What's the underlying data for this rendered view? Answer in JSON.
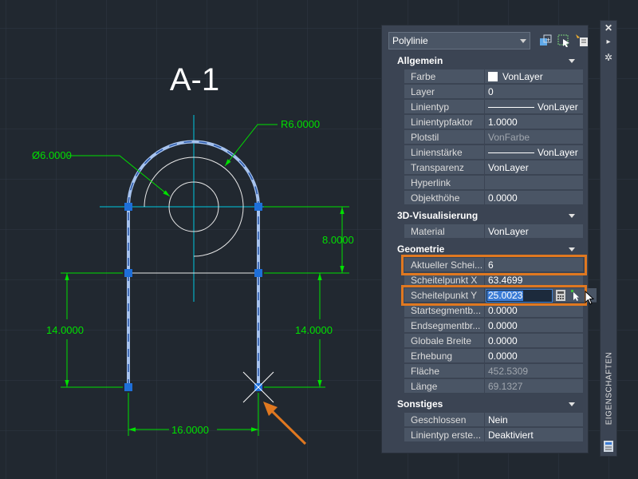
{
  "drawing": {
    "title": "A-1",
    "dim_diameter": "Ø6.0000",
    "dim_radius": "R6.0000",
    "dim_right_top": "8.0000",
    "dim_left": "14.0000",
    "dim_right": "14.0000",
    "dim_bottom": "16.0000"
  },
  "panel": {
    "object_type": "Polylinie",
    "vertical_title": "EIGENSCHAFTEN",
    "sections": [
      {
        "title": "Allgemein",
        "rows": [
          {
            "label": "Farbe",
            "value": "VonLayer"
          },
          {
            "label": "Layer",
            "value": "0"
          },
          {
            "label": "Linientyp",
            "value": "VonLayer"
          },
          {
            "label": "Linientypfaktor",
            "value": "1.0000"
          },
          {
            "label": "Plotstil",
            "value": "VonFarbe"
          },
          {
            "label": "Linienstärke",
            "value": "VonLayer"
          },
          {
            "label": "Transparenz",
            "value": "VonLayer"
          },
          {
            "label": "Hyperlink",
            "value": ""
          },
          {
            "label": "Objekthöhe",
            "value": "0.0000"
          }
        ]
      },
      {
        "title": "3D-Visualisierung",
        "rows": [
          {
            "label": "Material",
            "value": "VonLayer"
          }
        ]
      },
      {
        "title": "Geometrie",
        "rows": [
          {
            "label": "Aktueller Schei...",
            "value": "6"
          },
          {
            "label": "Scheitelpunkt X",
            "value": "63.4699"
          },
          {
            "label": "Scheitelpunkt Y",
            "value": "25.0023"
          },
          {
            "label": "Startsegmentb...",
            "value": "0.0000"
          },
          {
            "label": "Endsegmentbr...",
            "value": "0.0000"
          },
          {
            "label": "Globale Breite",
            "value": "0.0000"
          },
          {
            "label": "Erhebung",
            "value": "0.0000"
          },
          {
            "label": "Fläche",
            "value": "452.5309"
          },
          {
            "label": "Länge",
            "value": "69.1327"
          }
        ]
      },
      {
        "title": "Sonstiges",
        "rows": [
          {
            "label": "Geschlossen",
            "value": "Nein"
          },
          {
            "label": "Linientyp erste...",
            "value": "Deaktiviert"
          }
        ]
      }
    ]
  },
  "colors": {
    "background": "#212830",
    "dimension": "#00e000",
    "selection": "#7fa8e8",
    "grip": "#1e6fd9",
    "highlight": "#e07820"
  }
}
